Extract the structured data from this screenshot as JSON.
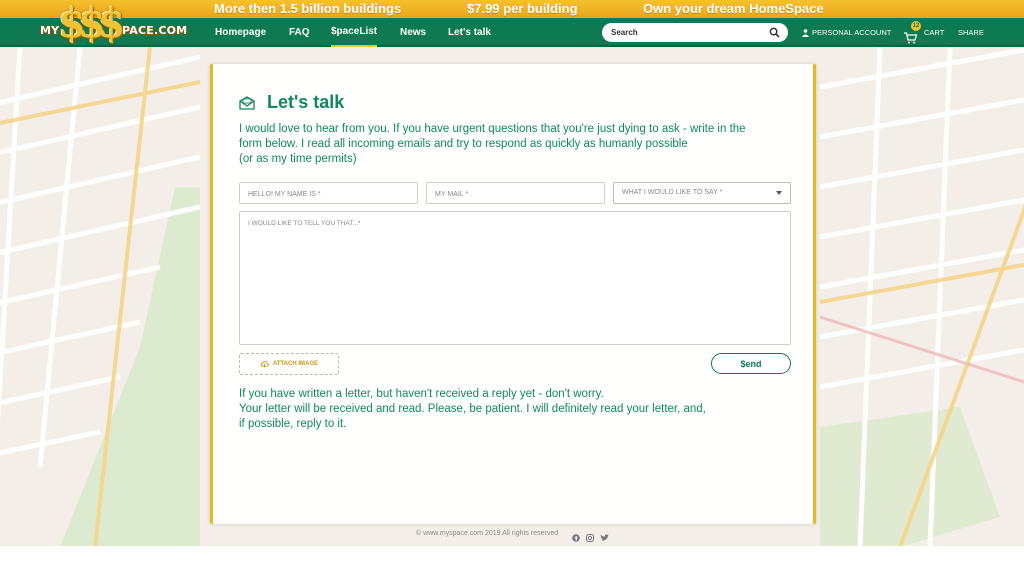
{
  "promo": {
    "buildings": "More then 1.5 billion buildings",
    "price": "$7.99 per building",
    "slogan": "Own your dream HomeSpace"
  },
  "logo": {
    "prefix": "MY",
    "dollars": "$$$",
    "suffix": "PACE.COM"
  },
  "nav": {
    "items": [
      {
        "label": "Homepage"
      },
      {
        "label": "FAQ"
      },
      {
        "label": "$paceList"
      },
      {
        "label": "News"
      },
      {
        "label": "Let's talk"
      }
    ],
    "search_placeholder": "Search",
    "account_label": "PERSONAL ACCOUNT",
    "cart_label": "CART",
    "cart_count": "12",
    "share_label": "SHARE"
  },
  "contact": {
    "title": "Let's talk",
    "intro_line1": "I would love to hear from you. If you have urgent questions that you're just dying to ask - write in the",
    "intro_line2": "form below. I read all incoming emails and try to respond as quickly as humanly possible",
    "intro_line3": "(or as my time permits)",
    "name_placeholder": "HELLO! MY NAME IS *",
    "mail_placeholder": "MY MAIL *",
    "topic_selected": "WHAT I WOULD LIKE TO SAY *",
    "message_placeholder": "I WOULD LIKE TO TELL YOU THAT...*",
    "attach_label": "ATTACH IMAGE",
    "send_label": "$end",
    "outro_line1": "If you have written a letter, but haven't received a reply yet - don't worry.",
    "outro_line2": "Your letter will be received and read. Please, be patient. I will definitely read your letter, and,",
    "outro_line3": "if possible, reply to it."
  },
  "footer": {
    "copyright": "© www.myspace.com 2019 All rights reserved"
  },
  "colors": {
    "brand_green": "#0e7a52",
    "text_green": "#0e8a5c",
    "gold": "#e6b823"
  }
}
